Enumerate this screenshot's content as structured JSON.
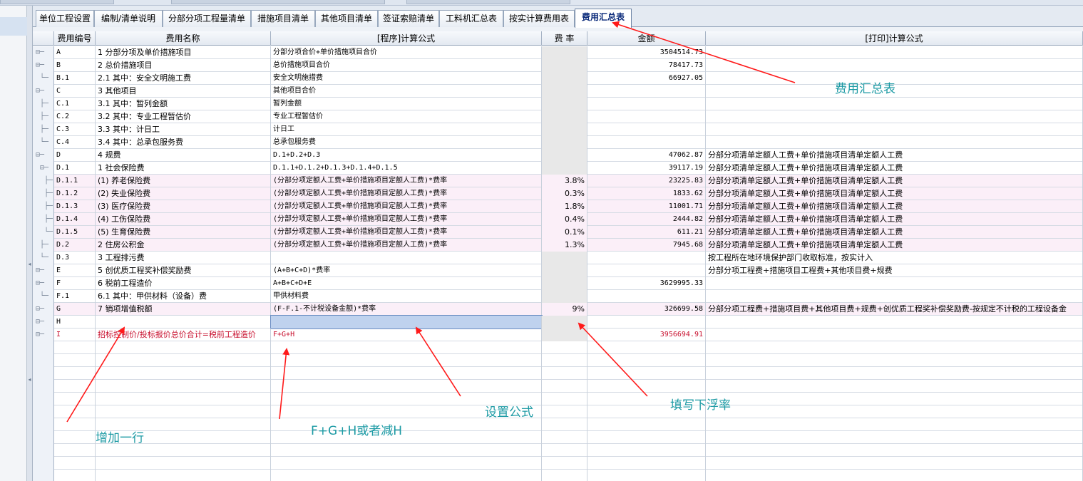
{
  "tabs": [
    {
      "label": "单位工程设置",
      "active": false
    },
    {
      "label": "编制/清单说明",
      "active": false
    },
    {
      "label": "分部分项工程量清单",
      "active": false
    },
    {
      "label": "措施项目清单",
      "active": false
    },
    {
      "label": "其他项目清单",
      "active": false
    },
    {
      "label": "签证索赔清单",
      "active": false
    },
    {
      "label": "工料机汇总表",
      "active": false
    },
    {
      "label": "按实计算费用表",
      "active": false
    },
    {
      "label": "费用汇总表",
      "active": true
    }
  ],
  "columns": [
    "费用编号",
    "费用名称",
    "[程序]计算公式",
    "费 率",
    "金额",
    "[打印]计算公式"
  ],
  "rows": [
    {
      "tree": "⊟─",
      "code": "A",
      "name": "1 分部分项及单价措施项目",
      "formula": "分部分项合价+单价措施项目合价",
      "rate": "",
      "amount": "3504514.73",
      "print": "",
      "style": ""
    },
    {
      "tree": "⊟─",
      "code": "B",
      "name": "2 总价措施项目",
      "formula": "总价措施项目合价",
      "rate": "",
      "amount": "78417.73",
      "print": "",
      "style": ""
    },
    {
      "tree": " └─",
      "code": "B.1",
      "name": "2.1 其中：安全文明施工费",
      "formula": "安全文明施措费",
      "rate": "",
      "amount": "66927.05",
      "print": "",
      "style": ""
    },
    {
      "tree": "⊟─",
      "code": "C",
      "name": "3 其他项目",
      "formula": "其他项目合价",
      "rate": "",
      "amount": "",
      "print": "",
      "style": ""
    },
    {
      "tree": " ├─",
      "code": "C.1",
      "name": "3.1 其中：暂列金额",
      "formula": "暂列金额",
      "rate": "",
      "amount": "",
      "print": "",
      "style": ""
    },
    {
      "tree": " ├─",
      "code": "C.2",
      "name": "3.2 其中：专业工程暂估价",
      "formula": "专业工程暂估价",
      "rate": "",
      "amount": "",
      "print": "",
      "style": ""
    },
    {
      "tree": " ├─",
      "code": "C.3",
      "name": "3.3 其中：计日工",
      "formula": "计日工",
      "rate": "",
      "amount": "",
      "print": "",
      "style": ""
    },
    {
      "tree": " └─",
      "code": "C.4",
      "name": "3.4 其中：总承包服务费",
      "formula": "总承包服务费",
      "rate": "",
      "amount": "",
      "print": "",
      "style": ""
    },
    {
      "tree": "⊟─",
      "code": "D",
      "name": "4 规费",
      "formula": "D.1+D.2+D.3",
      "rate": "",
      "amount": "47062.87",
      "print": "分部分项清单定额人工费+单价措施项目清单定额人工费",
      "style": ""
    },
    {
      "tree": " ⊟─",
      "code": "D.1",
      "name": "1 社会保险费",
      "formula": "D.1.1+D.1.2+D.1.3+D.1.4+D.1.5",
      "rate": "",
      "amount": "39117.19",
      "print": "分部分项清单定额人工费+单价措施项目清单定额人工费",
      "style": ""
    },
    {
      "tree": "  ├─",
      "code": "D.1.1",
      "name": "(1) 养老保险费",
      "formula": "(分部分项定额人工费+单价措施项目定额人工费)*费率",
      "rate": "3.8%",
      "amount": "23225.83",
      "print": "分部分项清单定额人工费+单价措施项目清单定额人工费",
      "style": "pink"
    },
    {
      "tree": "  ├─",
      "code": "D.1.2",
      "name": "(2) 失业保险费",
      "formula": "(分部分项定额人工费+单价措施项目定额人工费)*费率",
      "rate": "0.3%",
      "amount": "1833.62",
      "print": "分部分项清单定额人工费+单价措施项目清单定额人工费",
      "style": "pink"
    },
    {
      "tree": "  ├─",
      "code": "D.1.3",
      "name": "(3) 医疗保险费",
      "formula": "(分部分项定额人工费+单价措施项目定额人工费)*费率",
      "rate": "1.8%",
      "amount": "11001.71",
      "print": "分部分项清单定额人工费+单价措施项目清单定额人工费",
      "style": "pink"
    },
    {
      "tree": "  ├─",
      "code": "D.1.4",
      "name": "(4) 工伤保险费",
      "formula": "(分部分项定额人工费+单价措施项目定额人工费)*费率",
      "rate": "0.4%",
      "amount": "2444.82",
      "print": "分部分项清单定额人工费+单价措施项目清单定额人工费",
      "style": "pink"
    },
    {
      "tree": "  └─",
      "code": "D.1.5",
      "name": "(5) 生育保险费",
      "formula": "(分部分项定额人工费+单价措施项目定额人工费)*费率",
      "rate": "0.1%",
      "amount": "611.21",
      "print": "分部分项清单定额人工费+单价措施项目清单定额人工费",
      "style": "pink"
    },
    {
      "tree": " ├─",
      "code": "D.2",
      "name": "2 住房公积金",
      "formula": "(分部分项定额人工费+单价措施项目定额人工费)*费率",
      "rate": "1.3%",
      "amount": "7945.68",
      "print": "分部分项清单定额人工费+单价措施项目清单定额人工费",
      "style": "pink"
    },
    {
      "tree": " └─",
      "code": "D.3",
      "name": "3 工程排污费",
      "formula": "",
      "rate": "",
      "amount": "",
      "print": "按工程所在地环境保护部门收取标准，按实计入",
      "style": ""
    },
    {
      "tree": "⊟─",
      "code": "E",
      "name": "5 创优质工程奖补偿奖励费",
      "formula": "(A+B+C+D)*费率",
      "rate": "",
      "amount": "",
      "print": "分部分项工程费+措施项目工程费+其他项目费+规费",
      "style": ""
    },
    {
      "tree": "⊟─",
      "code": "F",
      "name": "6 税前工程造价",
      "formula": "A+B+C+D+E",
      "rate": "",
      "amount": "3629995.33",
      "print": "",
      "style": ""
    },
    {
      "tree": " └─",
      "code": "F.1",
      "name": "6.1 其中：甲供材料（设备）费",
      "formula": "甲供材料费",
      "rate": "",
      "amount": "",
      "print": "",
      "style": ""
    },
    {
      "tree": "⊟─",
      "code": "G",
      "name": "7 销项增值税额",
      "formula": "(F-F.1-不计税设备金额)*费率",
      "rate": "9%",
      "amount": "326699.58",
      "print": "分部分项工程费+措施项目费+其他项目费+规费+创优质工程奖补偿奖励费-按规定不计税的工程设备金",
      "style": "pink"
    },
    {
      "tree": "⊟─",
      "code": "H",
      "name": "",
      "formula": "",
      "rate": "",
      "amount": "",
      "print": "",
      "style": "selected"
    },
    {
      "tree": "⊟─",
      "code": "I",
      "name": "招标控制价/投标报价总价合计=税前工程造价",
      "formula": "F+G+H",
      "rate": "",
      "amount": "3956694.91",
      "print": "",
      "style": "red"
    }
  ],
  "annotations": {
    "summary_table": "费用汇总表",
    "set_formula": "设置公式",
    "fill_rate": "填写下浮率",
    "add_row": "增加一行",
    "fgh": "F+G+H或者减H"
  },
  "colors": {
    "annotation": "#1c9aa4",
    "arrow": "#ff1a1a",
    "pink_row": "#fbeff8",
    "red_text": "#c8102e",
    "selected": "#bfd2ee"
  }
}
